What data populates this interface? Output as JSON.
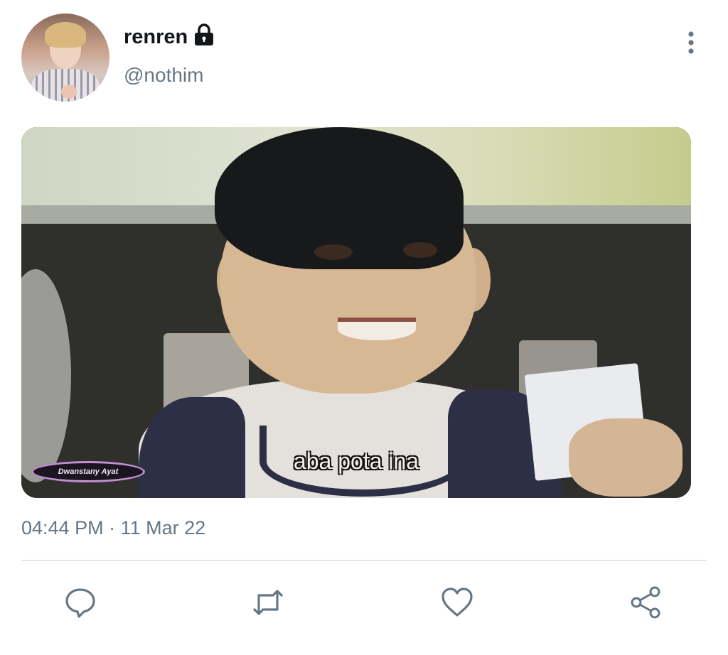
{
  "tweet": {
    "display_name": "renren",
    "handle": "@nothim",
    "media": {
      "subtitle": "aba pota ina",
      "watermark": "Dwanstany Ayat"
    },
    "timestamp": "04:44 PM · 11 Mar 22"
  },
  "icons": {
    "lock": "lock-icon",
    "more": "more-vertical-icon",
    "reply": "reply-icon",
    "retweet": "retweet-icon",
    "like": "heart-icon",
    "share": "share-icon"
  },
  "colors": {
    "text_primary": "#14171a",
    "text_secondary": "#657786",
    "icon": "#657786",
    "divider": "#e1e8ed"
  }
}
